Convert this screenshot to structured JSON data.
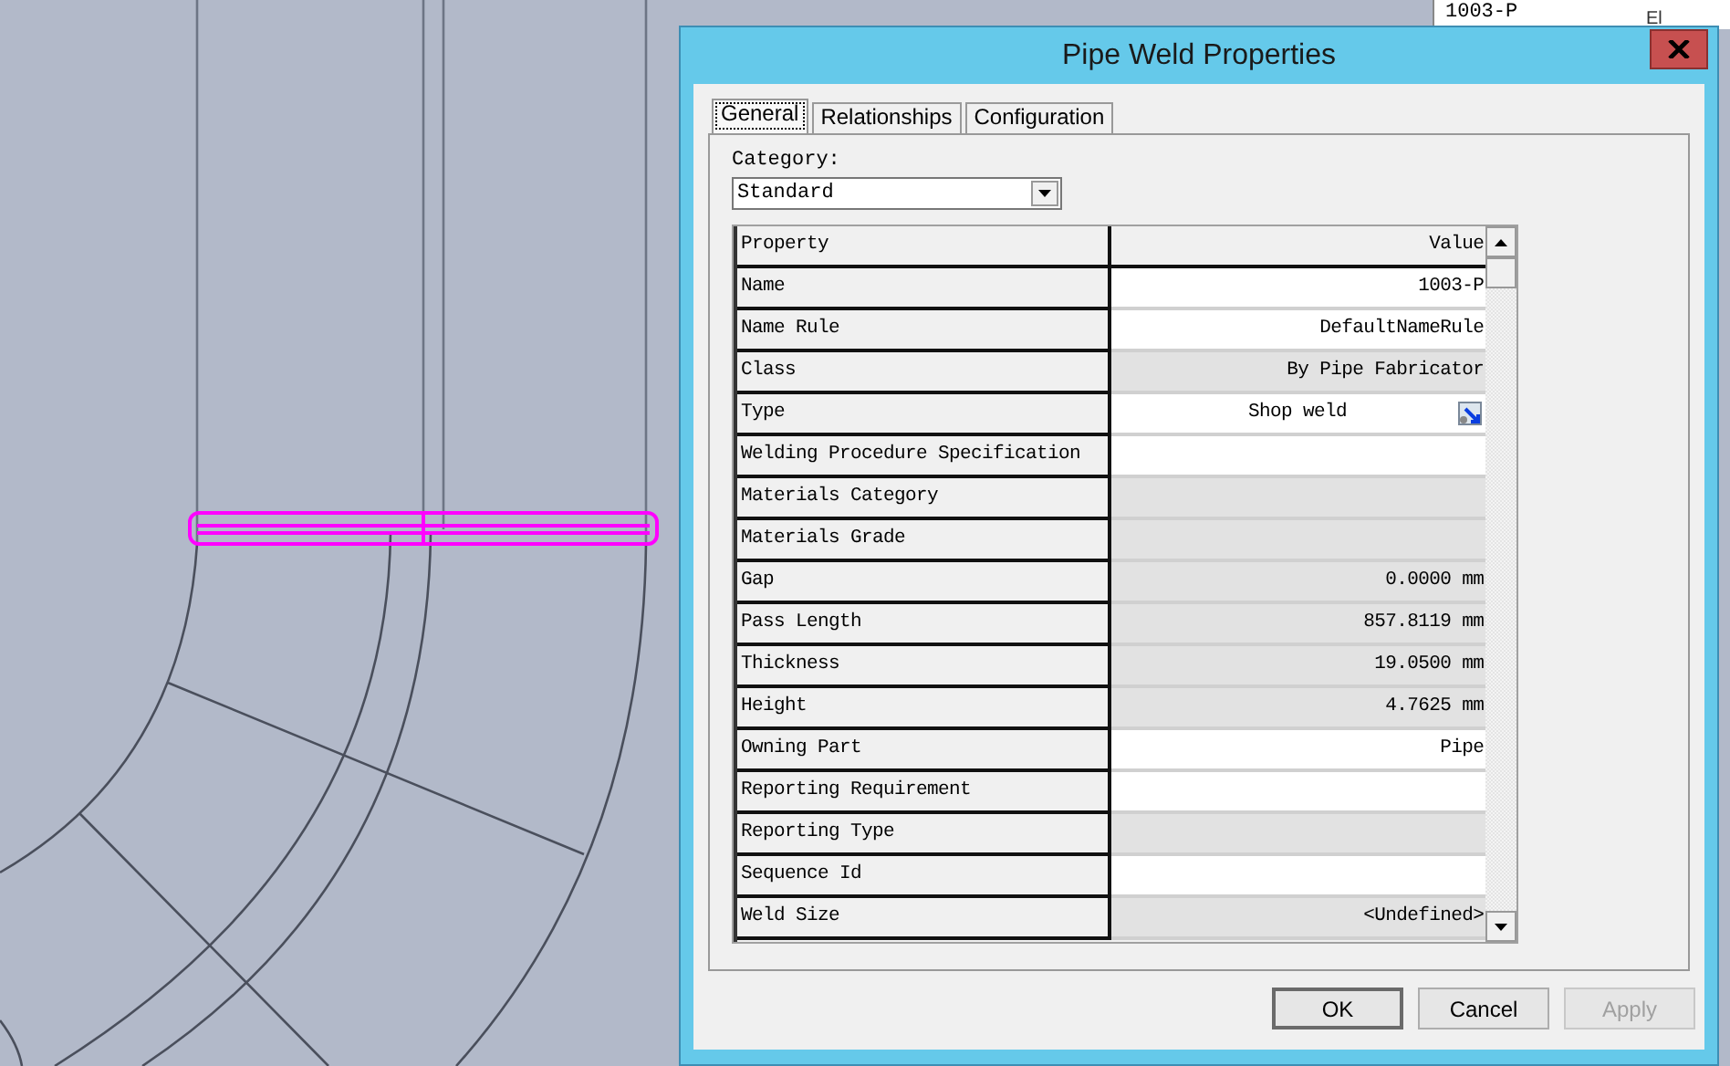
{
  "canvas": {
    "labels": [
      "El"
    ],
    "side_panel": {
      "value": "1003-P"
    }
  },
  "dialog": {
    "title": "Pipe Weld Properties",
    "tabs": [
      {
        "label": "General",
        "selected": true
      },
      {
        "label": "Relationships",
        "selected": false
      },
      {
        "label": "Configuration",
        "selected": false
      }
    ],
    "category": {
      "label": "Category:",
      "value": "Standard"
    },
    "grid": {
      "columns": [
        "Property",
        "Value"
      ],
      "rows": [
        {
          "property": "Name",
          "value": "1003-P",
          "editable": true,
          "picker": false
        },
        {
          "property": "Name Rule",
          "value": "DefaultNameRule",
          "editable": true,
          "picker": false
        },
        {
          "property": "Class",
          "value": "By Pipe Fabricator",
          "editable": false,
          "picker": false
        },
        {
          "property": "Type",
          "value": "Shop weld",
          "editable": true,
          "picker": true
        },
        {
          "property": "Welding Procedure Specification",
          "value": "",
          "editable": true,
          "picker": false
        },
        {
          "property": "Materials Category",
          "value": "",
          "editable": false,
          "picker": false
        },
        {
          "property": "Materials Grade",
          "value": "",
          "editable": false,
          "picker": false
        },
        {
          "property": "Gap",
          "value": "0.0000 mm",
          "editable": false,
          "picker": false
        },
        {
          "property": "Pass Length",
          "value": "857.8119 mm",
          "editable": false,
          "picker": false
        },
        {
          "property": "Thickness",
          "value": "19.0500 mm",
          "editable": false,
          "picker": false
        },
        {
          "property": "Height",
          "value": "4.7625 mm",
          "editable": false,
          "picker": false
        },
        {
          "property": "Owning Part",
          "value": "Pipe",
          "editable": true,
          "picker": false
        },
        {
          "property": "Reporting Requirement",
          "value": "",
          "editable": true,
          "picker": false
        },
        {
          "property": "Reporting Type",
          "value": "",
          "editable": false,
          "picker": false
        },
        {
          "property": "Sequence Id",
          "value": "",
          "editable": true,
          "picker": false
        },
        {
          "property": "Weld Size",
          "value": "<Undefined>",
          "editable": false,
          "picker": false
        }
      ]
    },
    "buttons": [
      {
        "label": "OK",
        "disabled": false
      },
      {
        "label": "Cancel",
        "disabled": false
      },
      {
        "label": "Apply",
        "disabled": true
      }
    ]
  }
}
